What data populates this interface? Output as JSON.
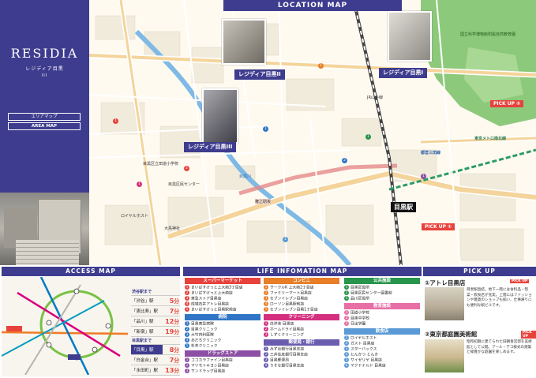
{
  "brand": {
    "logo": "RESIDIA",
    "sub": "レジディア目黒",
    "sub2": "III",
    "tag_area": "エリアマップ",
    "tag_area_en": "AREA MAP"
  },
  "map": {
    "title": "LOCATION MAP",
    "residences": [
      "レジディア目黒II",
      "レジディア目黒I",
      "レジディア目黒III"
    ],
    "station": "目黒駅",
    "pickups": [
      "PICK UP ②",
      "PICK UP ①"
    ],
    "labels": {
      "jr_line": "JR山手線",
      "nanboku": "東京メトロ南北線",
      "mita": "都営三田線",
      "meguro_river": "目黒川",
      "park": "国立科学博物館附属自然教育園",
      "yamate_dori": "山手通り",
      "meguro_dori": "目黒通り",
      "gondawara": "権之助坂",
      "ohtori": "大鳥神社",
      "royal": "ロイヤルホスト",
      "shoei": "目黒区民センター",
      "school": "目黒区立田道小学校"
    }
  },
  "access": {
    "title": "ACCESS MAP",
    "header1": "渋谷駅まで",
    "rows": [
      {
        "station": "「渋谷」駅",
        "min": "5"
      },
      {
        "station": "「恵比寿」駅",
        "min": "7"
      },
      {
        "station": "「品川」駅",
        "min": "12"
      },
      {
        "station": "「新宿」駅",
        "min": "19"
      }
    ],
    "header2": "目黒駅まで",
    "station_main": "「目黒」駅",
    "main_min": "8",
    "rows2": [
      {
        "station": "「白金台」駅",
        "min": "7"
      },
      {
        "station": "「永田町」駅",
        "min": "13"
      }
    ],
    "unit": "分"
  },
  "life": {
    "title": "LIFE INFOMATION MAP",
    "categories": {
      "super": "スーパーマーケット",
      "conv": "コンビニ",
      "public": "公共施設",
      "hospital": "病院",
      "cleaning": "クリーニング",
      "drug": "ドラッグストア",
      "bank": "郵便局・銀行",
      "school": "教育施設",
      "food": "飲食店"
    },
    "super_items": [
      "まいばすけっと上大崎3丁目店",
      "まいばすけっと上大崎店",
      "東急ストア目黒店",
      "成城石井アトレ目黒店",
      "まいばすけっと目黒駅前店"
    ],
    "conv_items": [
      "サークルK 上大崎2丁目店",
      "ファミリーマート目黒店",
      "セブンイレブン目黒店",
      "ローソン目黒駅前店",
      "セブンイレブン目黒1丁目店"
    ],
    "public_items": [
      "目黒区役所",
      "目黒区民センター図書館",
      "品川区役所"
    ],
    "hospital_items": [
      "目黒東急病院",
      "目黒クリニック",
      "大竹内科医院",
      "あだちクリニック",
      "杉本クリニック"
    ],
    "cleaning_items": [
      "白洋舎 目黒店",
      "ホームドライ目黒店",
      "しずくクリーニング"
    ],
    "drug_items": [
      "ココカラファイン目黒店",
      "マツモトキヨシ目黒店",
      "サンドラッグ目黒店"
    ],
    "bank_items": [
      "みずほ銀行目黒支店",
      "三井住友銀行目黒支店",
      "目黒郵便局",
      "りそな銀行目黒支店"
    ],
    "school_items": [
      "田道小学校",
      "目黒中学校",
      "日出学園"
    ],
    "food_items": [
      "ロイヤルホスト",
      "ガスト 目黒店",
      "スターバックス",
      "とんかつ とんき",
      "サイゼリヤ 目黒店",
      "マクドナルド 目黒店"
    ]
  },
  "pickup": {
    "title": "PICK UP",
    "item1_title": "①アトレ目黒店",
    "item1_desc": "目黒駅直結。地下一階には食料品・惣菜・飲食店が充実。上階にはファッションや雑貨のショップも揃い、仕事帰りにも便利な駅ビルです。",
    "item2_title": "②東京都庭園美術館",
    "item2_desc": "昭和初期に建てられた旧朝香宮邸を美術館として公開。アール・デコ様式の建築と緑豊かな庭園を楽しめます。",
    "badge": "PICK UP",
    "colors": {
      "accent": "#3e3c8e",
      "red": "#e8423c"
    }
  }
}
